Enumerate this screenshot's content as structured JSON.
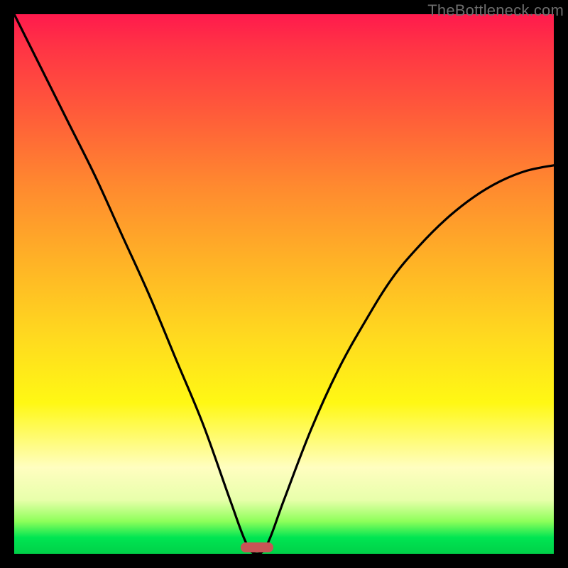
{
  "watermark": "TheBottleneck.com",
  "chart_data": {
    "type": "line",
    "title": "",
    "xlabel": "",
    "ylabel": "",
    "xlim": [
      0,
      100
    ],
    "ylim": [
      0,
      100
    ],
    "grid": false,
    "series": [
      {
        "name": "bottleneck-curve",
        "x": [
          0,
          5,
          10,
          15,
          20,
          25,
          30,
          35,
          40,
          43,
          45,
          47,
          50,
          55,
          60,
          65,
          70,
          75,
          80,
          85,
          90,
          95,
          100
        ],
        "values": [
          100,
          90,
          80,
          70,
          59,
          48,
          36,
          24,
          10,
          2,
          0,
          2,
          10,
          23,
          34,
          43,
          51,
          57,
          62,
          66,
          69,
          71,
          72
        ]
      }
    ],
    "optimal_marker": {
      "x_start": 42,
      "x_end": 48,
      "color": "#c85456"
    },
    "background_gradient": {
      "top": "#ff1a4d",
      "mid": "#ffda1f",
      "bottom": "#00d048"
    }
  },
  "marker_label": ""
}
